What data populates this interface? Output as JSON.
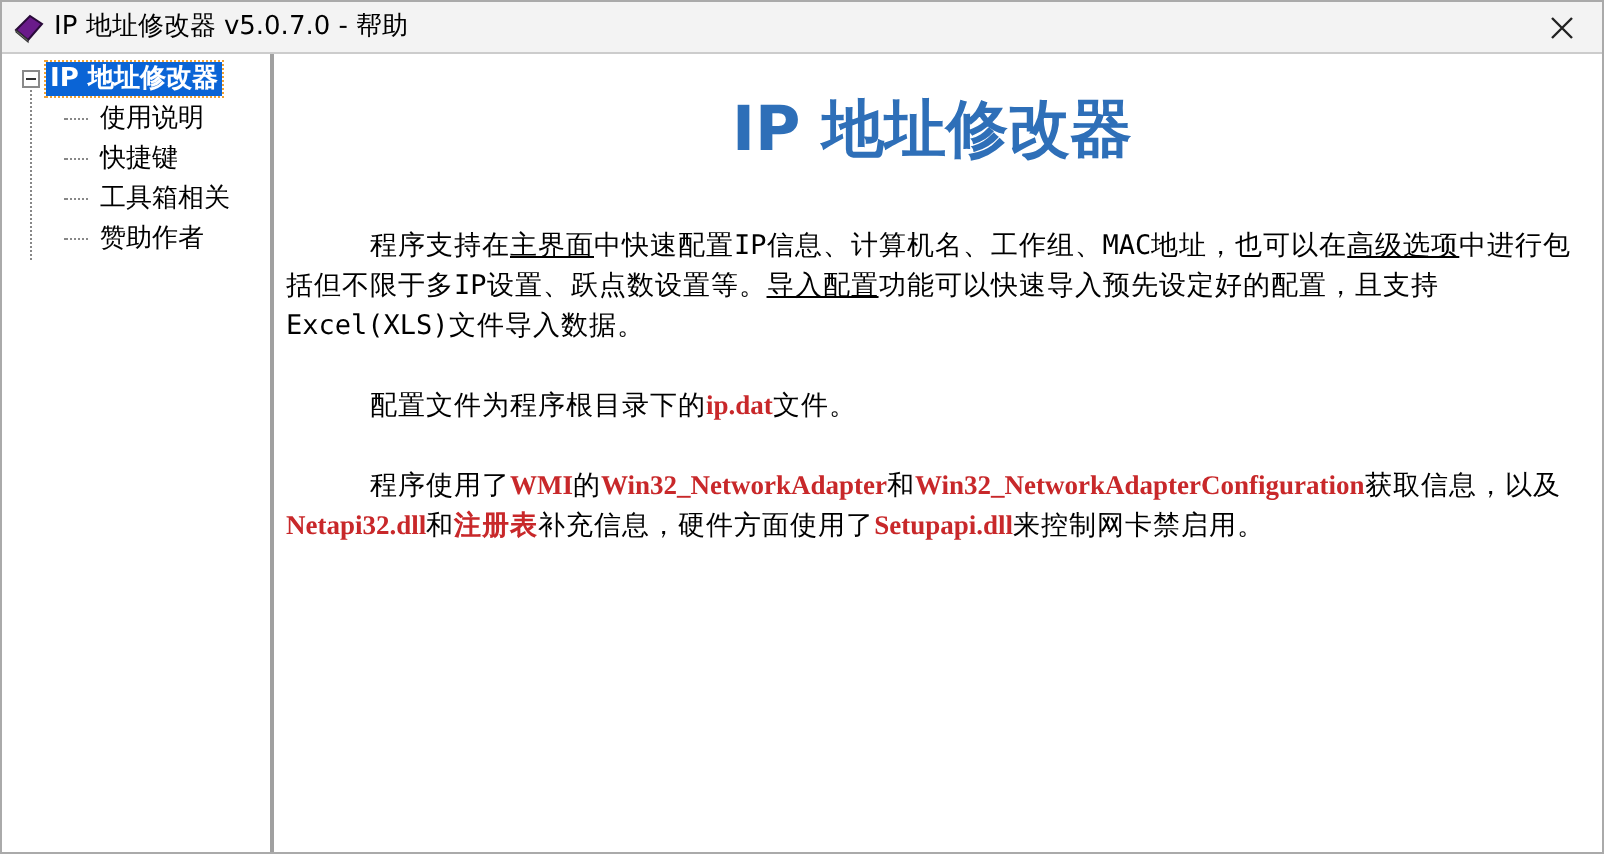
{
  "window": {
    "title": "IP 地址修改器 v5.0.7.0 - 帮助"
  },
  "tree": {
    "label": "IP 地址修改器",
    "selected": true,
    "expanded": true,
    "children": [
      {
        "label": "使用说明",
        "selected": false
      },
      {
        "label": "快捷键",
        "selected": false
      },
      {
        "label": "工具箱相关",
        "selected": false
      },
      {
        "label": "赞助作者",
        "selected": false
      }
    ]
  },
  "page": {
    "heading": "IP 地址修改器",
    "paragraphs": [
      [
        {
          "kind": "plain",
          "text": "程序支持在"
        },
        {
          "kind": "link",
          "text": "主界面"
        },
        {
          "kind": "plain",
          "text": "中快速配置IP信息、计算机名、工作组、MAC地址，也可以在"
        },
        {
          "kind": "link",
          "text": "高级选项"
        },
        {
          "kind": "plain",
          "text": "中进行包括但不限于多IP设置、跃点数设置等。"
        },
        {
          "kind": "link",
          "text": "导入配置"
        },
        {
          "kind": "plain",
          "text": "功能可以快速导入预先设定好的配置，且支持Excel(XLS)文件导入数据。"
        }
      ],
      [
        {
          "kind": "plain",
          "text": "配置文件为程序根目录下的"
        },
        {
          "kind": "highlight",
          "text": "ip.dat"
        },
        {
          "kind": "plain",
          "text": "文件。"
        }
      ],
      [
        {
          "kind": "plain",
          "text": "程序使用了"
        },
        {
          "kind": "highlight",
          "text": "WMI"
        },
        {
          "kind": "plain",
          "text": "的"
        },
        {
          "kind": "highlight",
          "text": "Win32_NetworkAdapter"
        },
        {
          "kind": "plain",
          "text": "和"
        },
        {
          "kind": "highlight",
          "text": "Win32_NetworkAdapterConfiguration"
        },
        {
          "kind": "plain",
          "text": "获取信息，以及"
        },
        {
          "kind": "highlight",
          "text": "Netapi32.dll"
        },
        {
          "kind": "plain",
          "text": "和"
        },
        {
          "kind": "highlight",
          "text": "注册表"
        },
        {
          "kind": "plain",
          "text": "补充信息，硬件方面使用了"
        },
        {
          "kind": "highlight",
          "text": "Setupapi.dll"
        },
        {
          "kind": "plain",
          "text": "来控制网卡禁启用。"
        }
      ]
    ]
  }
}
